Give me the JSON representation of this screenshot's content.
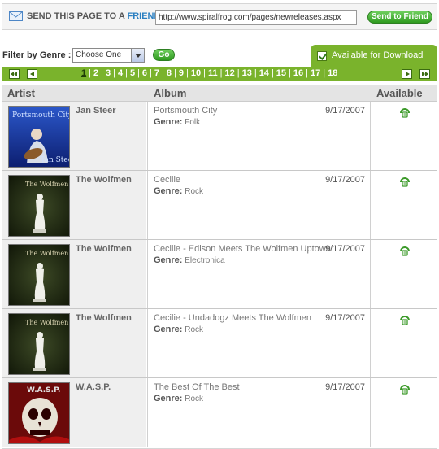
{
  "send_bar": {
    "label_prefix": "SEND THIS PAGE TO A ",
    "label_friend": "FRIEND",
    "label_colon": ":",
    "url_value": "http://www.spiralfrog.com/pages/newreleases.aspx",
    "send_button": "Send to Friend"
  },
  "filter": {
    "label": "Filter by Genre :",
    "selected": "Choose One",
    "go_button": "Go",
    "available_checkbox_label": "Available for Download",
    "available_checked": true
  },
  "pager": {
    "pages": [
      "1",
      "2",
      "3",
      "4",
      "5",
      "6",
      "7",
      "8",
      "9",
      "10",
      "11",
      "12",
      "13",
      "14",
      "15",
      "16",
      "17",
      "18"
    ],
    "current": "1",
    "separator": "|"
  },
  "table": {
    "headers": {
      "artist": "Artist",
      "album": "Album",
      "available": "Available"
    },
    "genre_label": "Genre:",
    "rows": [
      {
        "artist": "Jan Steer",
        "album": "Portsmouth City",
        "genre": "Folk",
        "date": "9/17/2007",
        "cover_title": "Portsmouth City",
        "cover_artist": "Jan Steer"
      },
      {
        "artist": "The Wolfmen",
        "album": "Cecilie",
        "genre": "Rock",
        "date": "9/17/2007",
        "cover_title": "The Wolfmen"
      },
      {
        "artist": "The Wolfmen",
        "album": "Cecilie - Edison Meets The Wolfmen Uptown",
        "genre": "Electronica",
        "date": "9/17/2007",
        "cover_title": "The Wolfmen"
      },
      {
        "artist": "The Wolfmen",
        "album": "Cecilie - Undadogz Meets The Wolfmen",
        "genre": "Rock",
        "date": "9/17/2007",
        "cover_title": "The Wolfmen"
      },
      {
        "artist": "W.A.S.P.",
        "album": "The Best Of The Best",
        "genre": "Rock",
        "date": "9/17/2007",
        "cover_title": "W.A.S.P."
      }
    ]
  },
  "colors": {
    "accent_green": "#7ab32c",
    "link_blue": "#2a7fc1",
    "button_green": "#2f9a1f"
  }
}
